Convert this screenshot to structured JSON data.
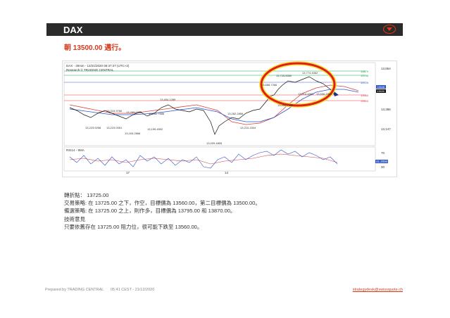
{
  "header": {
    "title": "DAX"
  },
  "headline": "朝 13500.00 邁行。",
  "chart": {
    "title_line1": "DAX - 30min - 12/21/2020 05:37:27 (UTC+2)",
    "title_line2": "Research © TRADING CENTRAL",
    "indicator_label": "RSI14 - 9MA",
    "price_labels": {
      "p1": "13,774.4062",
      "p2": "13,725.8350",
      "p3": "13,686.7266",
      "p4": "13,614.4961",
      "p5": "13,530.3301",
      "p6": "13,499.7402",
      "p7": "13,454.1289",
      "p8": "13,315.9766",
      "p9": "13,289.0302",
      "p10": "13,282.7686",
      "p11": "13,282.2856",
      "p12": "13,223.9258",
      "p13": "13,223.0051",
      "p14": "13,199.4502",
      "p15": "13,163.2666",
      "p16": "13,210.1504",
      "p17": "13,009.4805"
    },
    "right_axis": {
      "a1": "13,864",
      "a2": "13,386",
      "a3": "13,147",
      "r70": "70",
      "r41": "41.2094",
      "r30": "30"
    },
    "level_tags": {
      "l1": "13870",
      "l2": "13795",
      "l3": "13725",
      "l4": "13648",
      "l5": "13630",
      "l6": "13560",
      "l7": "13500"
    },
    "x_labels": {
      "x1": "17",
      "x2": "14"
    }
  },
  "body": {
    "line1": "轉折點： 13725.00",
    "line2": "交易策略: 在 13725.00 之下，作空，目標價為 13560.00，第二目標價為 13500.00。",
    "line3": "備選策略: 在 13725.00 之上，則作多，目標價為 13795.00 和 13870.00。",
    "line4": "技術意見",
    "line5": "只要依舊存在 13725.00 阻力位，很可能下跌至 13560.00。"
  },
  "footer": {
    "prepared": "Prepared by TRADING CENTRAL",
    "datetime": "05:41 CEST - 21/12/2020",
    "link": "strategydesk@swissquote.ch"
  },
  "colors": {
    "accent": "#d63a1e",
    "header_bg": "#2b2b2b",
    "highlight": "#f2e21a"
  }
}
